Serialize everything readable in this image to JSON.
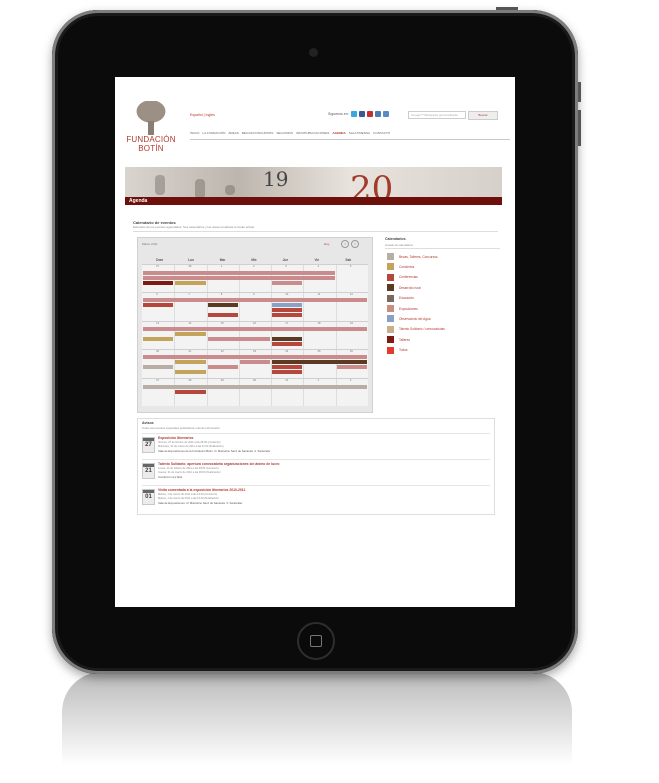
{
  "header": {
    "brand_line1": "FUNDACIÓN",
    "brand_line2": "BOTÍN",
    "lang": "Español | Inglés",
    "follow": "Síguenos en:",
    "search_placeholder": "Google™ Búsqueda personalizada",
    "search_button": "Buscar"
  },
  "nav": [
    "INICIO",
    "LA FUNDACIÓN",
    "ÁREAS",
    "BECAS/CONCURSOS",
    "SEGUIMOS",
    "INFO/PUBLICACIONES",
    "AGENDA",
    "SALA PRENSA",
    "CONTACTO"
  ],
  "banner": {
    "left_numeral": "19",
    "right_numeral": "20",
    "section": "Agenda"
  },
  "calendar": {
    "title": "Calendario de eventos",
    "subtitle": "Estimado de los eventos agendados. Sus calendarios y las áreas temáticas le harán actuar.",
    "month_label": "Marzo 2011",
    "today_label": "Hoy",
    "days": [
      "Dom",
      "Lun",
      "Mar",
      "Mie",
      "Jue",
      "Vie",
      "Sab"
    ],
    "day_numbers": [
      [
        "27",
        "28",
        "1",
        "2",
        "3",
        "4",
        "5"
      ],
      [
        "6",
        "7",
        "8",
        "9",
        "10",
        "11",
        "12"
      ],
      [
        "13",
        "14",
        "15",
        "16",
        "17",
        "18",
        "19"
      ],
      [
        "20",
        "21",
        "22",
        "23",
        "24",
        "25",
        "26"
      ],
      [
        "27",
        "28",
        "29",
        "30",
        "31",
        "1",
        "2"
      ]
    ]
  },
  "legend": {
    "title": "Calendarios",
    "subtitle": "Listado de calendarios",
    "items": [
      {
        "label": "Becas, Talleres, Concursos",
        "color": "#b7aea6"
      },
      {
        "label": "Conciertos",
        "color": "#c4a35a"
      },
      {
        "label": "Conferencias",
        "color": "#b5473c"
      },
      {
        "label": "Desarrollo rural",
        "color": "#5a3a22"
      },
      {
        "label": "Educación",
        "color": "#7a6a5e"
      },
      {
        "label": "Exposiciones",
        "color": "#c88f7e"
      },
      {
        "label": "Observatorio del Agua",
        "color": "#8aa0c4"
      },
      {
        "label": "Talento Solidario / convocatorias",
        "color": "#c9b08a"
      },
      {
        "label": "Talleres",
        "color": "#7e1914"
      },
      {
        "label": "Todos",
        "color": "#e33a2c"
      }
    ]
  },
  "avisos": {
    "title": "Avisos",
    "subtitle": "Todos sus eventos especiales publicitarios más de información",
    "items": [
      {
        "day": "27",
        "title": "Exposición Itinerarios",
        "line1": "Viernes, 27 de febrero de 2011 a las 09:00 (comienzo)",
        "line2": "Miércoles, 31 de marzo de 2011 a las 21:00 (finalización)",
        "location": "Sala de Exposiciones de la Fundación Botín. C/ Marcelino Sanz de Sautuola, 3. Santander"
      },
      {
        "day": "21",
        "title": "Talento Solidario: apertura convocatoria organizaciones sin ánimo de lucro",
        "line1": "Lunes, 21 de febrero de 2011 a las 09:00 (comienzo)",
        "line2": "Jueves, 31 de marzo de 2011 a las 09:00 (finalización)",
        "location": "Inscripción vía Web"
      },
      {
        "day": "01",
        "title": "Visita comentada a la exposición Itinerarios 2010-2011",
        "line1": "Martes, 1 de marzo de 2011 a las 12:00 (comienzo)",
        "line2": "Martes, 1 de marzo de 2011 a las 12:30 (finalización)",
        "location": "Sala de Exposiciones. C/ Marcelino Sanz de Sautuola, 3. Santander"
      }
    ]
  }
}
